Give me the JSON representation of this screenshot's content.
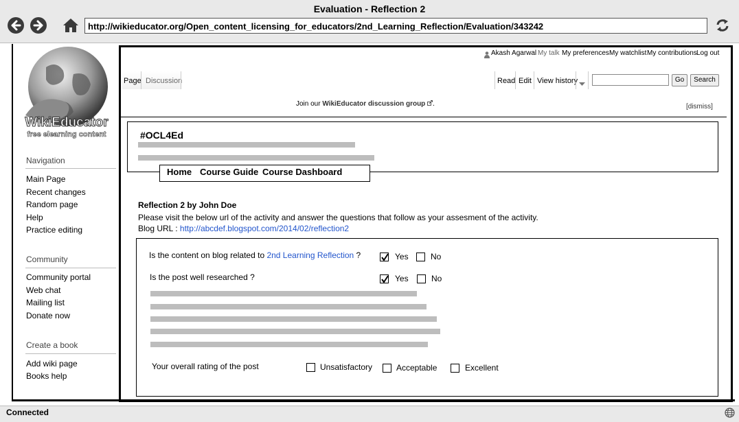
{
  "window": {
    "title": "Evaluation - Reflection 2"
  },
  "browser": {
    "url": "http://wikieducator.org/Open_content_licensing_for_educators/2nd_Learning_Reflection/Evaluation/343242",
    "icons": [
      "back-arrow-icon",
      "forward-arrow-icon",
      "home-icon",
      "reload-icon",
      "globe-icon"
    ]
  },
  "personal": {
    "user": "Akash Agarwal",
    "talk": "My talk",
    "preferences": "My preferences",
    "watchlist": "My watchlist",
    "contributions": "My contributions",
    "logout": "Log out"
  },
  "tabs": {
    "page": "Page",
    "discussion": "Discussion",
    "read": "Read",
    "edit": "Edit",
    "history": "View history",
    "go": "Go",
    "search": "Search"
  },
  "notice": {
    "prefix": "Join our ",
    "link": "WikiEducator discussion group",
    "suffix": ".",
    "dismiss": "[dismiss]"
  },
  "logo": {
    "line1": "WikiEducator",
    "line2": "free elearning content"
  },
  "sidebar": {
    "navigation_title": "Navigation",
    "navigation": [
      "Main Page",
      "Recent changes",
      "Random page",
      "Help",
      "Practice editing"
    ],
    "community_title": "Community",
    "community": [
      "Community portal",
      "Web chat",
      "Mailing list",
      "Donate now"
    ],
    "book_title": "Create a book",
    "book": [
      "Add wiki page",
      "Books help"
    ]
  },
  "course": {
    "hashtag": "#OCL4Ed",
    "nav": [
      "Home",
      "Course Guide",
      "Course Dashboard"
    ]
  },
  "reflection": {
    "title": "Reflection 2 by John Doe",
    "description": "Please visit the below url of the activity and answer the questions that follow as your assesment of the activity.",
    "blog_label": "Blog URL : ",
    "blog_url": "http://abcdef.blogspot.com/2014/02/reflection2"
  },
  "evaluation": {
    "q1_prefix": "Is the content on blog related to ",
    "q1_link": "2nd Learning Reflection",
    "q1_suffix": " ?",
    "q2": "Is the post well researched ?",
    "yes": "Yes",
    "no": "No",
    "q1_answer": "Yes",
    "q2_answer": "Yes",
    "rating_label": "Your overall rating of the post",
    "ratings": [
      "Unsatisfactory",
      "Acceptable",
      "Excellent"
    ]
  },
  "status": {
    "text": "Connected"
  },
  "colors": {
    "link": "#2255cc",
    "chrome": "#e9e9e9",
    "placeholder_bar": "#bdbdbd"
  }
}
